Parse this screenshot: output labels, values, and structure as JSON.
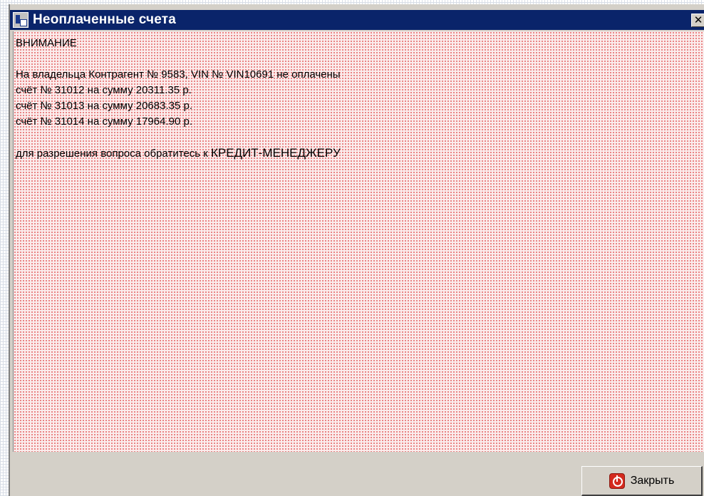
{
  "window": {
    "title": "Неоплаченные счета",
    "close_glyph": "✕"
  },
  "message": {
    "header": "ВНИМАНИЕ",
    "intro": "На владельца Контрагент № 9583, VIN № VIN10691 не оплачены",
    "invoices": [
      "счёт № 31012 на сумму 20311.35 р.",
      "счёт № 31013 на сумму 20683.35 р.",
      "счёт № 31014 на сумму 17964.90 р."
    ],
    "footer_prefix": "для разрешения вопроса обратитесь к ",
    "footer_emphasis": "КРЕДИТ-МЕНЕДЖЕРУ"
  },
  "buttons": {
    "close_label": "Закрыть"
  },
  "icons": {
    "app": "app-icon",
    "close": "close-icon",
    "button": "power-icon"
  },
  "colors": {
    "titlebar": "#0a246a",
    "content_background": "#fbecec",
    "content_dots": "#e46a6a",
    "face": "#d4d0c8",
    "power_icon": "#d42a1e"
  }
}
